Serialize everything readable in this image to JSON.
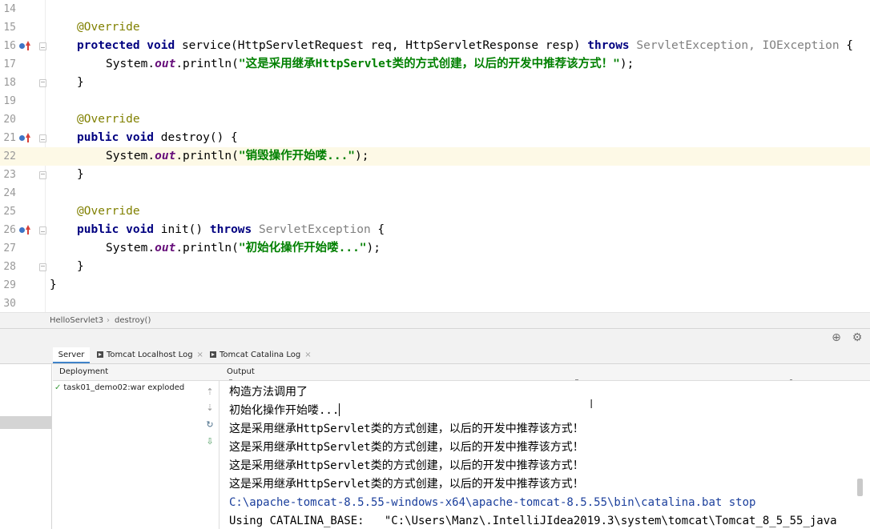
{
  "editor": {
    "lines": [
      {
        "num": "14",
        "code": ""
      },
      {
        "num": "15",
        "annotation": "@Override"
      },
      {
        "num": "16",
        "kw": "protected void",
        "sig": " service(HttpServletRequest req, HttpServletResponse resp) ",
        "throws": "throws",
        "ex": " ServletException, IOException",
        "end": " {"
      },
      {
        "num": "17",
        "pre": "System.",
        "field": "out",
        "call": ".println(",
        "str": "\"这是采用继承HttpServlet类的方式创建，以后的开发中推荐该方式！\"",
        "post": ");"
      },
      {
        "num": "18",
        "code": "}"
      },
      {
        "num": "19",
        "code": ""
      },
      {
        "num": "20",
        "annotation": "@Override"
      },
      {
        "num": "21",
        "kw": "public void",
        "sig": " destroy() {"
      },
      {
        "num": "22",
        "pre": "System.",
        "field": "out",
        "call": ".println(",
        "str": "\"销毁操作开始喽...\"",
        "post": ");"
      },
      {
        "num": "23",
        "code": "}"
      },
      {
        "num": "24",
        "code": ""
      },
      {
        "num": "25",
        "annotation": "@Override"
      },
      {
        "num": "26",
        "kw": "public void",
        "sig": " init() ",
        "throws": "throws",
        "ex": " ServletException",
        "end": " {"
      },
      {
        "num": "27",
        "pre": "System.",
        "field": "out",
        "call": ".println(",
        "str": "\"初始化操作开始喽...\"",
        "post": ");"
      },
      {
        "num": "28",
        "code": "}"
      },
      {
        "num": "29",
        "code": "}"
      },
      {
        "num": "30",
        "code": ""
      }
    ]
  },
  "breadcrumb": {
    "class_name": "HelloServlet3",
    "separator": "›",
    "method": "destroy()"
  },
  "tabs": [
    {
      "label": "Server"
    },
    {
      "label": "Tomcat Localhost Log",
      "close": "×"
    },
    {
      "label": "Tomcat Catalina Log",
      "close": "×"
    }
  ],
  "deployment": {
    "header": "Deployment",
    "item": "task01_demo02:war exploded"
  },
  "output": {
    "header": "Output",
    "lines": [
      "构造方法调用了",
      "初始化操作开始喽...",
      "这是采用继承HttpServlet类的方式创建，以后的开发中推荐该方式！",
      "这是采用继承HttpServlet类的方式创建，以后的开发中推荐该方式！",
      "这是采用继承HttpServlet类的方式创建，以后的开发中推荐该方式！",
      "这是采用继承HttpServlet类的方式创建，以后的开发中推荐该方式！",
      "C:\\apache-tomcat-8.5.55-windows-x64\\apache-tomcat-8.5.55\\bin\\catalina.bat stop",
      "Using CATALINA_BASE:   \"C:\\Users\\Manz\\.IntelliJIdea2019.3\\system\\tomcat\\Tomcat_8_5_55_java"
    ]
  },
  "icons": {
    "settings": "gear-icon",
    "layout": "crosshair-icon"
  }
}
